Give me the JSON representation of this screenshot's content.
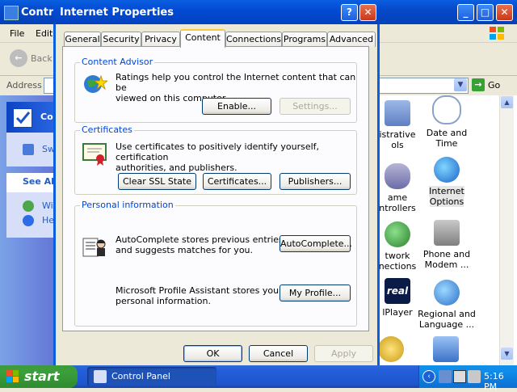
{
  "control_panel": {
    "title": "Control Panel",
    "title_visible": "Contro",
    "menu": [
      "File",
      "Edit"
    ],
    "back_label": "Back",
    "address_label": "Address",
    "go_label": "Go",
    "sidebar": {
      "panel1_header": "Co",
      "panel1_item": "Sw",
      "panel2_header": "See Al",
      "panel2_items": [
        "Wi",
        "He"
      ]
    },
    "items": [
      {
        "label_line1": "istrative",
        "label_line2": "ols",
        "icon": "admin-tools-icon"
      },
      {
        "label_line1": "Date and Time",
        "label_line2": "",
        "icon": "date-time-icon"
      },
      {
        "label_line1": "ame",
        "label_line2": "ntrollers",
        "icon": "game-controllers-icon"
      },
      {
        "label_line1": "Internet",
        "label_line2": "Options",
        "icon": "internet-options-icon"
      },
      {
        "label_line1": "twork",
        "label_line2": "nections",
        "icon": "network-connections-icon"
      },
      {
        "label_line1": "Phone and",
        "label_line2": "Modem ...",
        "icon": "phone-modem-icon"
      },
      {
        "label_line1": "lPlayer",
        "label_line2": "",
        "icon": "realplayer-icon",
        "icon_text": "real"
      },
      {
        "label_line1": "Regional and",
        "label_line2": "Language ...",
        "icon": "regional-language-icon"
      }
    ]
  },
  "dialog": {
    "title": "Internet Properties",
    "help_glyph": "?",
    "close_glyph": "✕",
    "tabs": [
      "General",
      "Security",
      "Privacy",
      "Content",
      "Connections",
      "Programs",
      "Advanced"
    ],
    "active_tab": "Content",
    "content_advisor": {
      "label": "Content Advisor",
      "text_line1": "Ratings help you control the Internet content that can be",
      "text_line2": "viewed on this computer.",
      "enable_button": "Enable...",
      "settings_button": "Settings..."
    },
    "certificates": {
      "label": "Certificates",
      "text_line1": "Use certificates to positively identify yourself, certification",
      "text_line2": "authorities, and publishers.",
      "clear_ssl_button": "Clear SSL State",
      "certificates_button": "Certificates...",
      "publishers_button": "Publishers..."
    },
    "personal_information": {
      "label": "Personal information",
      "autocomplete_text_line1": "AutoComplete stores previous entries",
      "autocomplete_text_line2": "and suggests matches for you.",
      "autocomplete_button": "AutoComplete...",
      "profile_text_line1": "Microsoft Profile Assistant stores your",
      "profile_text_line2": "personal information.",
      "profile_button": "My Profile..."
    },
    "ok_button": "OK",
    "cancel_button": "Cancel",
    "apply_button": "Apply"
  },
  "taskbar": {
    "start_label": "start",
    "task_label": "Control Panel",
    "clock": "5:16 PM",
    "tray_chevron": "‹"
  },
  "colors": {
    "xp_blue": "#0A5FE0",
    "group_label": "#0046D5",
    "start_green": "#3C9A3C",
    "tab_highlight": "#FFC73C"
  }
}
